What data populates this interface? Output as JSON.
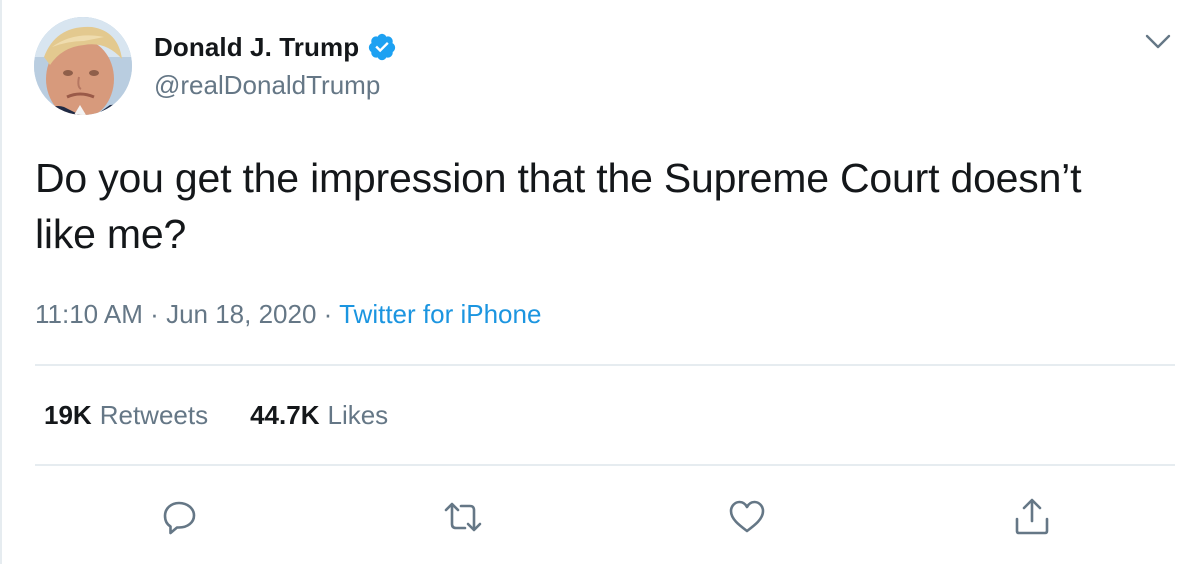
{
  "author": {
    "display_name": "Donald J. Trump",
    "handle": "@realDonaldTrump",
    "verified": true,
    "avatar_icon": "profile-photo"
  },
  "tweet": {
    "text": "Do you get the impression that the Supreme Court doesn’t like me?",
    "time": "11:10 AM",
    "separator": "·",
    "date": "Jun 18, 2020",
    "source": "Twitter for iPhone"
  },
  "stats": {
    "retweets_count": "19K",
    "retweets_label": "Retweets",
    "likes_count": "44.7K",
    "likes_label": "Likes"
  },
  "actions": {
    "reply_icon": "speech-bubble",
    "retweet_icon": "retweet-arrows",
    "like_icon": "heart-outline",
    "share_icon": "share-upload"
  },
  "menu_icon": "chevron-down",
  "colors": {
    "text": "#14171a",
    "secondary": "#657786",
    "link": "#1b95e0",
    "verified": "#1da1f2",
    "divider": "#e6ecf0"
  }
}
